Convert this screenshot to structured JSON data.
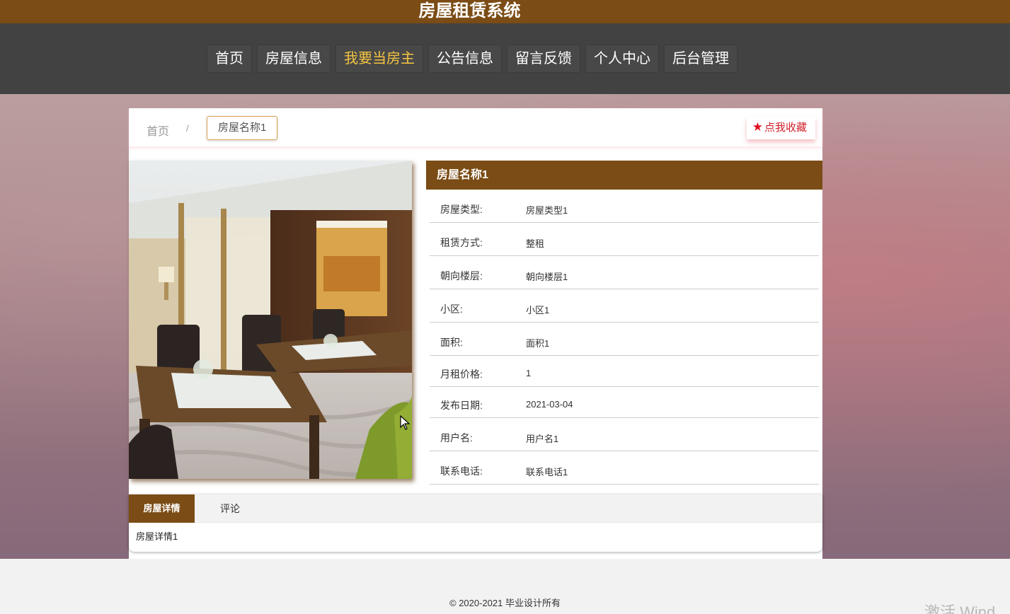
{
  "header": {
    "site_title": "房屋租赁系统"
  },
  "nav": {
    "items": [
      {
        "label": "首页"
      },
      {
        "label": "房屋信息"
      },
      {
        "label": "我要当房主",
        "active": true
      },
      {
        "label": "公告信息"
      },
      {
        "label": "留言反馈"
      },
      {
        "label": "个人中心"
      },
      {
        "label": "后台管理"
      }
    ]
  },
  "breadcrumb": {
    "home": "首页",
    "separator": "/",
    "current": "房屋名称1"
  },
  "favorite": {
    "icon": "star-icon",
    "label": "点我收藏"
  },
  "house": {
    "title": "房屋名称1",
    "fields": [
      {
        "label": "房屋类型:",
        "value": "房屋类型1"
      },
      {
        "label": "租赁方式:",
        "value": "整租"
      },
      {
        "label": "朝向楼层:",
        "value": "朝向楼层1"
      },
      {
        "label": "小区:",
        "value": "小区1"
      },
      {
        "label": "面积:",
        "value": "面积1"
      },
      {
        "label": "月租价格:",
        "value": "1"
      },
      {
        "label": "发布日期:",
        "value": "2021-03-04"
      },
      {
        "label": "用户名:",
        "value": "用户名1"
      },
      {
        "label": "联系电话:",
        "value": "联系电话1"
      }
    ]
  },
  "tabs": {
    "items": [
      {
        "label": "房屋详情",
        "active": true
      },
      {
        "label": "评论"
      }
    ],
    "content": "房屋详情1"
  },
  "footer": {
    "copyright": "© 2020-2021 毕业设计所有",
    "watermark": "激活 Wind"
  },
  "colors": {
    "brand": "#7b4c15",
    "nav_bg": "#424242",
    "nav_active": "#f5c542",
    "favorite": "#d0202b"
  }
}
